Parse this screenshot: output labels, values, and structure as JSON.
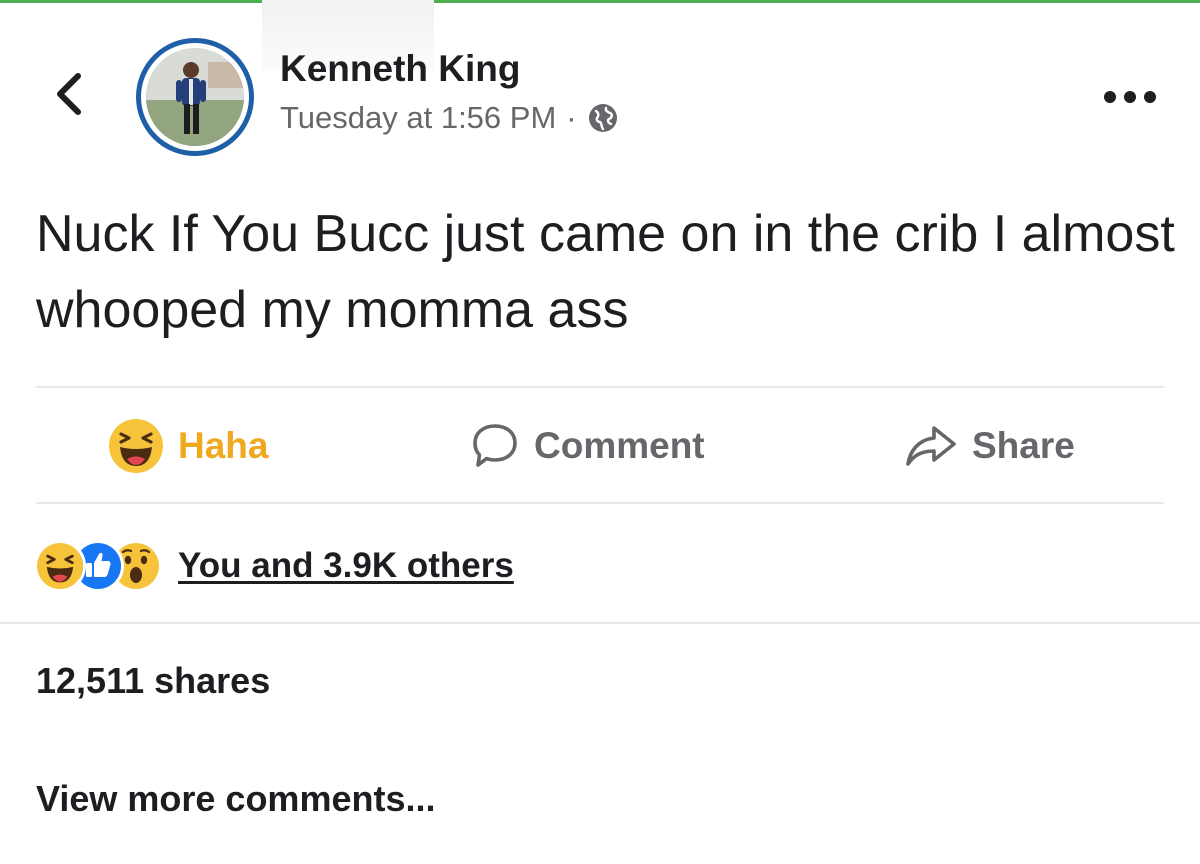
{
  "post": {
    "author_name": "Kenneth King",
    "timestamp": "Tuesday at 1:56 PM",
    "separator": "·",
    "privacy_icon": "globe-icon",
    "text": "Nuck If You Bucc just came on in the crib I almost whooped my momma ass"
  },
  "header": {
    "back_icon": "chevron-left-icon",
    "more_icon": "more-horizontal-icon"
  },
  "actions": {
    "react_label": "Haha",
    "comment_label": "Comment",
    "share_label": "Share"
  },
  "reactions": {
    "icons": [
      "haha-icon",
      "like-icon",
      "wow-icon"
    ],
    "summary": "You and 3.9K others"
  },
  "stats": {
    "shares": "12,511 shares"
  },
  "comments": {
    "view_more": "View more comments..."
  },
  "colors": {
    "haha_accent": "#f0a81f",
    "like_blue": "#1877f2",
    "avatar_ring": "#1f5fa8",
    "top_accent": "#4caf50",
    "muted_text": "#65676b"
  }
}
